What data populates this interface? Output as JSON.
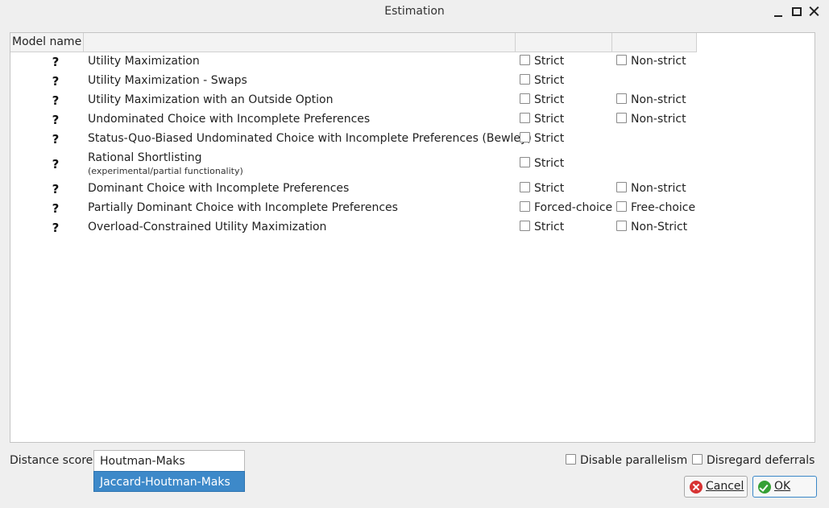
{
  "window": {
    "title": "Estimation"
  },
  "table": {
    "headers": [
      "Model name",
      "",
      "",
      ""
    ],
    "rows": [
      {
        "status": "?",
        "name": "Utility Maximization",
        "options": [
          "Strict",
          "Non-strict"
        ]
      },
      {
        "status": "?",
        "name": "Utility Maximization - Swaps",
        "options": [
          "Strict"
        ]
      },
      {
        "status": "?",
        "name": "Utility Maximization with an Outside Option",
        "options": [
          "Strict",
          "Non-strict"
        ]
      },
      {
        "status": "?",
        "name": "Undominated Choice with Incomplete Preferences",
        "options": [
          "Strict",
          "Non-strict"
        ]
      },
      {
        "status": "?",
        "name": "Status-Quo-Biased Undominated Choice with Incomplete Preferences (Bewley)",
        "options": [
          "Strict"
        ]
      },
      {
        "status": "?",
        "name": "Rational Shortlisting",
        "note": "(experimental/partial functionality)",
        "options": [
          "Strict"
        ]
      },
      {
        "status": "?",
        "name": "Dominant Choice with Incomplete Preferences",
        "options": [
          "Strict",
          "Non-strict"
        ]
      },
      {
        "status": "?",
        "name": "Partially Dominant Choice with Incomplete Preferences",
        "options": [
          "Forced-choice",
          "Free-choice"
        ]
      },
      {
        "status": "?",
        "name": "Overload-Constrained Utility Maximization",
        "options": [
          "Strict",
          "Non-Strict"
        ]
      }
    ]
  },
  "distance": {
    "label": "Distance score",
    "options": [
      "Houtman-Maks",
      "Jaccard-Houtman-Maks"
    ],
    "highlighted": "Jaccard-Houtman-Maks"
  },
  "options": {
    "disable_parallelism": "Disable parallelism",
    "disregard_deferrals": "Disregard deferrals"
  },
  "buttons": {
    "cancel": "Cancel",
    "ok": "OK"
  },
  "colors": {
    "selection": "#3d89c9",
    "ok_border": "#3a87c8"
  },
  "icons": {
    "cancel": "cancel-icon",
    "ok": "ok-icon"
  }
}
